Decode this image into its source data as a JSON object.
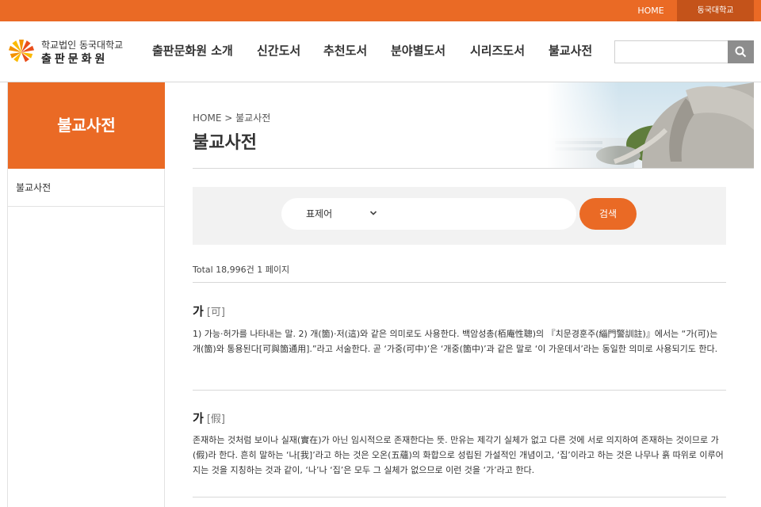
{
  "topbar": {
    "home": "HOME",
    "univ": "동국대학교"
  },
  "logo": {
    "line1": "학교법인 동국대학교",
    "line2": "출판문화원"
  },
  "nav": [
    "출판문화원 소개",
    "신간도서",
    "추천도서",
    "분야별도서",
    "시리즈도서",
    "불교사전"
  ],
  "search": {
    "placeholder": ""
  },
  "sidebar": {
    "title": "불교사전",
    "items": [
      "불교사전"
    ]
  },
  "breadcrumb": {
    "home": "HOME",
    "sep": ">",
    "current": "불교사전"
  },
  "page_title": "불교사전",
  "dict_search": {
    "select_value": "표제어",
    "input_value": "",
    "button": "검색"
  },
  "total_text": "Total 18,996건 1 페이지",
  "entries": [
    {
      "word": "가",
      "hanja": "[可]",
      "body": "1) 가능·허가를 나타내는 말. 2) 개(箇)·저(這)와 같은 의미로도 사용한다. 백암성총(栢庵性聰)의 『치문경훈주(緇門警訓註)』에서는 “가(可)는 개(箇)와 통용된다[可與箇通用].”라고 서술한다. 곧 ‘가중(可中)’은 ‘개중(箇中)’과 같은 말로 ‘이 가운데서’라는 동일한 의미로 사용되기도 한다."
    },
    {
      "word": "가",
      "hanja": "[假]",
      "body": "존재하는 것처럼 보이나 실재(實在)가 아닌 임시적으로 존재한다는 뜻. 만유는 제각기 실체가 없고 다른 것에 서로 의지하여 존재하는 것이므로 가(假)라 한다. 흔히 말하는 ‘나[我]’라고 하는 것은 오온(五蘊)의 화합으로 성립된 가설적인 개념이고, ‘집’이라고 하는 것은 나무나 흙 따위로 이루어지는 것을 지칭하는 것과 같이, ‘나’나 ‘집’은 모두 그 실체가 없으므로 이런 것을 ‘가’라고 한다."
    }
  ],
  "colors": {
    "accent": "#ea6a25",
    "accent_dark": "#c4531a",
    "panel": "#f2f2f2"
  }
}
